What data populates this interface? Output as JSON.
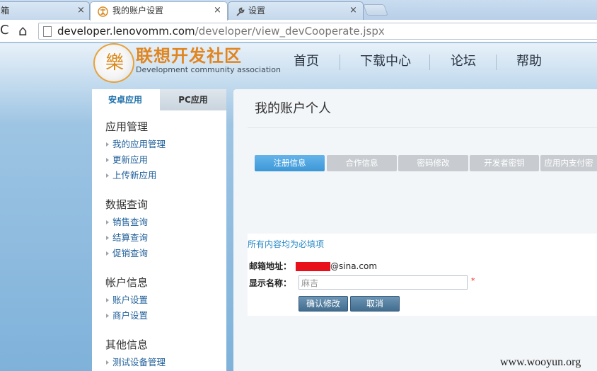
{
  "browser": {
    "tabs": [
      {
        "title": "箱",
        "active": false
      },
      {
        "title": "我的账户设置",
        "active": true
      },
      {
        "title": "设置",
        "active": false
      }
    ],
    "close_glyph": "×",
    "back_glyph": "C",
    "home_glyph": "⌂",
    "url_host": "developer.lenovomm.com",
    "url_path": "/developer/view_devCooperate.jspx"
  },
  "header": {
    "logo_glyph": "樂",
    "logo_cn": "联想开发社区",
    "logo_en": "Development community association",
    "nav": [
      "首页",
      "下载中心",
      "论坛",
      "帮助"
    ]
  },
  "sidebar": {
    "tabs": [
      "安卓应用",
      "PC应用"
    ],
    "groups": [
      {
        "title": "应用管理",
        "items": [
          "我的应用管理",
          "更新应用",
          "上传新应用"
        ]
      },
      {
        "title": "数据查询",
        "items": [
          "销售查询",
          "结算查询",
          "促销查询"
        ]
      },
      {
        "title": "帐户信息",
        "items": [
          "账户设置",
          "商户设置"
        ]
      },
      {
        "title": "其他信息",
        "items": [
          "测试设备管理"
        ]
      }
    ]
  },
  "main": {
    "title": "我的账户个人",
    "tabs": [
      "注册信息",
      "合作信息",
      "密码修改",
      "开发者密钥",
      "应用内支付密"
    ],
    "required_note": "所有内容均为必填项",
    "email_label": "邮箱地址：",
    "email_tail": "@sina.com",
    "name_label": "显示名称：",
    "name_value": "麻吉",
    "required_star": "*",
    "confirm_button": "确认修改",
    "cancel_button": "取消"
  },
  "watermark": "www.wooyun.org",
  "colors": {
    "accent": "#3d97d6",
    "logo": "#e0851f",
    "link": "#1f5f99",
    "redaction": "#e8101a"
  }
}
